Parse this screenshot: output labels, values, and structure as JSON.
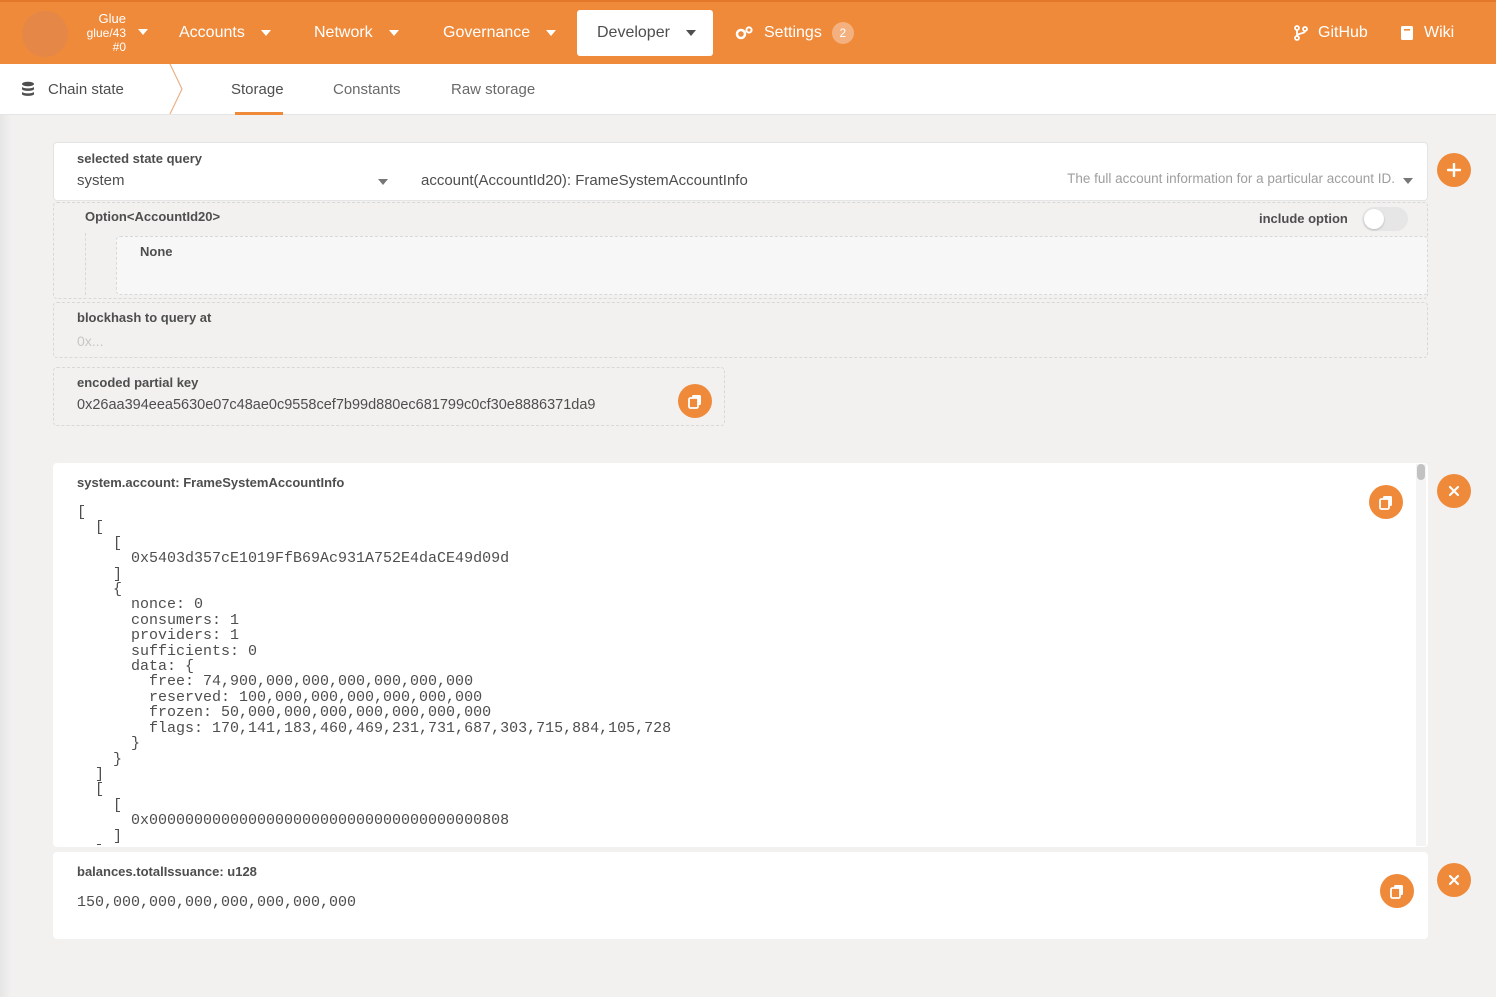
{
  "chain": {
    "name": "Glue",
    "spec": "glue/43",
    "block": "#0"
  },
  "nav": {
    "accounts": "Accounts",
    "network": "Network",
    "governance": "Governance",
    "developer": "Developer",
    "settings": "Settings",
    "settings_badge": "2",
    "github": "GitHub",
    "wiki": "Wiki"
  },
  "subnav": {
    "section": "Chain state",
    "tabs": [
      "Storage",
      "Constants",
      "Raw storage"
    ],
    "active_tab": "Storage"
  },
  "query": {
    "label": "selected state query",
    "module": "system",
    "method": "account(AccountId20): FrameSystemAccountInfo",
    "description": "The full account information for a particular account ID."
  },
  "param": {
    "label": "Option<AccountId20>",
    "include_option_label": "include option",
    "include_option_enabled": false,
    "value": "None"
  },
  "blockhash": {
    "label": "blockhash to query at",
    "placeholder": "0x..."
  },
  "encoded": {
    "label": "encoded partial key",
    "value": "0x26aa394eea5630e07c48ae0c9558cef7b99d880ec681799c0cf30e8886371da9"
  },
  "results": [
    {
      "title": "system.account: FrameSystemAccountInfo",
      "body": "[\n  [\n    [\n      0x5403d357cE1019FfB69Ac931A752E4daCE49d09d\n    ]\n    {\n      nonce: 0\n      consumers: 1\n      providers: 1\n      sufficients: 0\n      data: {\n        free: 74,900,000,000,000,000,000,000\n        reserved: 100,000,000,000,000,000,000\n        frozen: 50,000,000,000,000,000,000,000\n        flags: 170,141,183,460,469,231,731,687,303,715,884,105,728\n      }\n    }\n  ]\n  [\n    [\n      0x0000000000000000000000000000000000000808\n    ]\n  ]"
    },
    {
      "title": "balances.totalIssuance: u128",
      "body": "150,000,000,000,000,000,000,000"
    }
  ],
  "colors": {
    "accent": "#ef8a3a",
    "background": "#f2f1f0"
  }
}
